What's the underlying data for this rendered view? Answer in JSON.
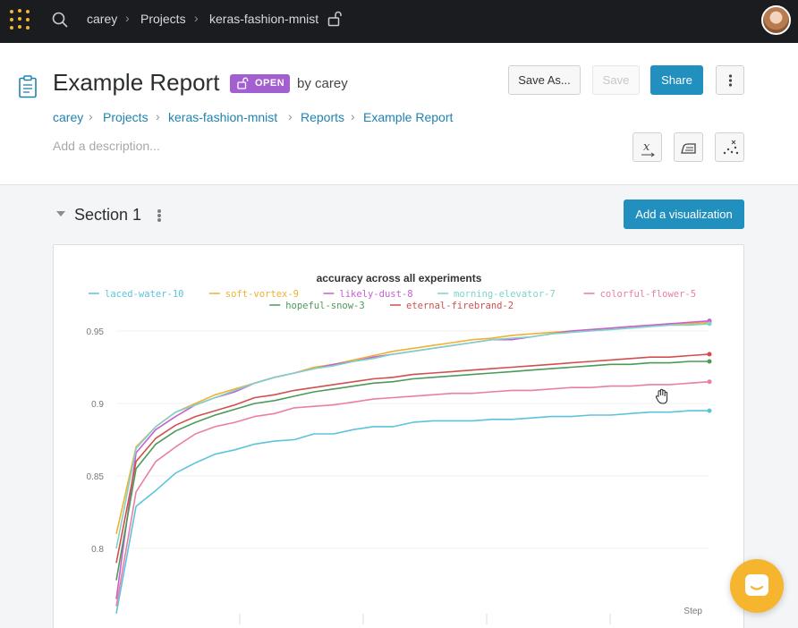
{
  "topbar": {
    "user": "carey",
    "projects": "Projects",
    "project": "keras-fashion-mnist"
  },
  "header": {
    "title": "Example Report",
    "badge": "OPEN",
    "author": "by carey",
    "save_as_label": "Save As...",
    "save_label": "Save",
    "share_label": "Share",
    "description_placeholder": "Add a description..."
  },
  "breadcrumb": [
    "carey",
    "Projects",
    "keras-fashion-mnist",
    "Reports",
    "Example Report"
  ],
  "section": {
    "title": "Section 1",
    "add_viz_label": "Add a visualization"
  },
  "colors": {
    "topbar": "#1a1c1f",
    "accent": "#2190bf",
    "badge": "#a35fcf",
    "brand_yellow": "#f5b52e"
  },
  "chart_data": {
    "type": "line",
    "title": "accuracy across all experiments",
    "xlabel": "Step",
    "ylabel": "",
    "ylim": [
      0.76,
      0.965
    ],
    "yticks": [
      0.8,
      0.85,
      0.9,
      0.95
    ],
    "ytick_labels": [
      "0.8",
      "0.85",
      "0.9",
      "0.95"
    ],
    "legend_position": "top-center",
    "x": [
      0,
      1,
      2,
      3,
      4,
      5,
      6,
      7,
      8,
      9,
      10,
      11,
      12,
      13,
      14,
      15,
      16,
      17,
      18,
      19,
      20,
      21,
      22,
      23,
      24,
      25,
      26,
      27,
      28,
      29,
      30
    ],
    "series": [
      {
        "name": "laced-water-10",
        "color": "#5cc3da",
        "values": [
          0.755,
          0.829,
          0.84,
          0.852,
          0.859,
          0.865,
          0.868,
          0.872,
          0.874,
          0.875,
          0.879,
          0.879,
          0.882,
          0.884,
          0.884,
          0.887,
          0.888,
          0.888,
          0.888,
          0.889,
          0.889,
          0.89,
          0.891,
          0.891,
          0.892,
          0.892,
          0.893,
          0.894,
          0.894,
          0.895,
          0.895
        ]
      },
      {
        "name": "soft-vortex-9",
        "color": "#efb133",
        "values": [
          0.81,
          0.87,
          0.884,
          0.894,
          0.9,
          0.906,
          0.91,
          0.914,
          0.918,
          0.921,
          0.925,
          0.927,
          0.93,
          0.933,
          0.936,
          0.938,
          0.94,
          0.942,
          0.944,
          0.945,
          0.947,
          0.948,
          0.949,
          0.95,
          0.951,
          0.952,
          0.953,
          0.954,
          0.955,
          0.955,
          0.956
        ]
      },
      {
        "name": "likely-dust-8",
        "color": "#c660d4",
        "values": [
          0.765,
          0.866,
          0.882,
          0.891,
          0.899,
          0.904,
          0.908,
          0.914,
          0.918,
          0.921,
          0.924,
          0.927,
          0.929,
          0.932,
          0.934,
          0.936,
          0.938,
          0.94,
          0.942,
          0.944,
          0.944,
          0.946,
          0.948,
          0.95,
          0.951,
          0.952,
          0.953,
          0.954,
          0.955,
          0.956,
          0.957
        ]
      },
      {
        "name": "morning-elevator-7",
        "color": "#7fd3c8",
        "values": [
          0.8,
          0.869,
          0.884,
          0.894,
          0.899,
          0.904,
          0.909,
          0.914,
          0.918,
          0.921,
          0.924,
          0.926,
          0.929,
          0.931,
          0.934,
          0.936,
          0.938,
          0.94,
          0.942,
          0.944,
          0.945,
          0.946,
          0.948,
          0.949,
          0.95,
          0.951,
          0.952,
          0.953,
          0.954,
          0.954,
          0.955
        ]
      },
      {
        "name": "colorful-flower-5",
        "color": "#ea7fa3",
        "values": [
          0.76,
          0.839,
          0.86,
          0.87,
          0.879,
          0.884,
          0.887,
          0.891,
          0.893,
          0.897,
          0.898,
          0.899,
          0.901,
          0.903,
          0.904,
          0.905,
          0.906,
          0.907,
          0.907,
          0.908,
          0.909,
          0.909,
          0.91,
          0.911,
          0.911,
          0.912,
          0.912,
          0.913,
          0.913,
          0.914,
          0.915
        ]
      },
      {
        "name": "hopeful-snow-3",
        "color": "#4c9a5a",
        "values": [
          0.778,
          0.855,
          0.872,
          0.881,
          0.887,
          0.892,
          0.896,
          0.9,
          0.902,
          0.905,
          0.908,
          0.91,
          0.912,
          0.914,
          0.915,
          0.917,
          0.918,
          0.919,
          0.92,
          0.921,
          0.922,
          0.923,
          0.924,
          0.925,
          0.926,
          0.927,
          0.927,
          0.928,
          0.928,
          0.929,
          0.929
        ]
      },
      {
        "name": "eternal-firebrand-2",
        "color": "#d24f4f",
        "values": [
          0.79,
          0.86,
          0.876,
          0.885,
          0.891,
          0.895,
          0.899,
          0.904,
          0.906,
          0.909,
          0.911,
          0.913,
          0.915,
          0.917,
          0.918,
          0.92,
          0.921,
          0.922,
          0.923,
          0.924,
          0.925,
          0.926,
          0.927,
          0.928,
          0.929,
          0.93,
          0.931,
          0.932,
          0.932,
          0.933,
          0.934
        ]
      }
    ]
  }
}
